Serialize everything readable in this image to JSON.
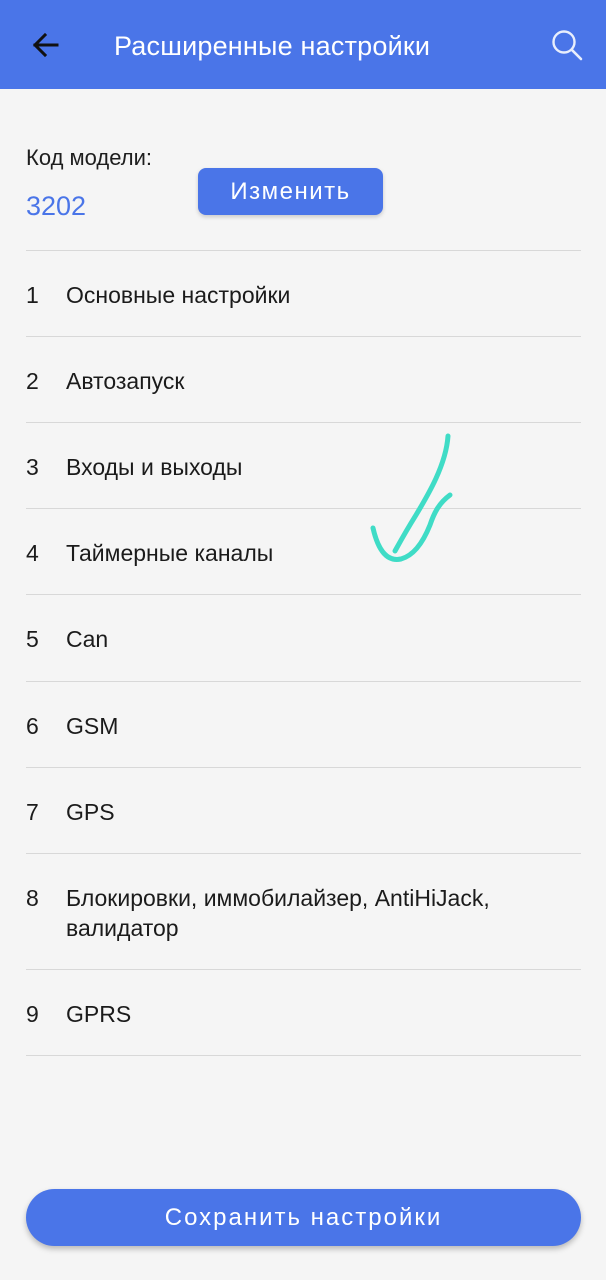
{
  "header": {
    "title": "Расширенные настройки",
    "back_icon": "arrow-left-icon",
    "search_icon": "search-icon",
    "background_color": "#4a75e8"
  },
  "model": {
    "label": "Код модели:",
    "value": "3202",
    "change_button": "Изменить"
  },
  "menu": [
    {
      "num": "1",
      "label": "Основные настройки"
    },
    {
      "num": "2",
      "label": "Автозапуск"
    },
    {
      "num": "3",
      "label": "Входы и выходы"
    },
    {
      "num": "4",
      "label": "Таймерные каналы"
    },
    {
      "num": "5",
      "label": "Can"
    },
    {
      "num": "6",
      "label": "GSM"
    },
    {
      "num": "7",
      "label": "GPS"
    },
    {
      "num": "8",
      "label": "Блокировки, иммобилайзер, AntiHiJack, валидатор"
    },
    {
      "num": "9",
      "label": "GPRS"
    }
  ],
  "footer": {
    "save_button": "Сохранить настройки"
  },
  "annotation": {
    "icon": "checkmark-annotation",
    "color": "#3fdcc6"
  }
}
